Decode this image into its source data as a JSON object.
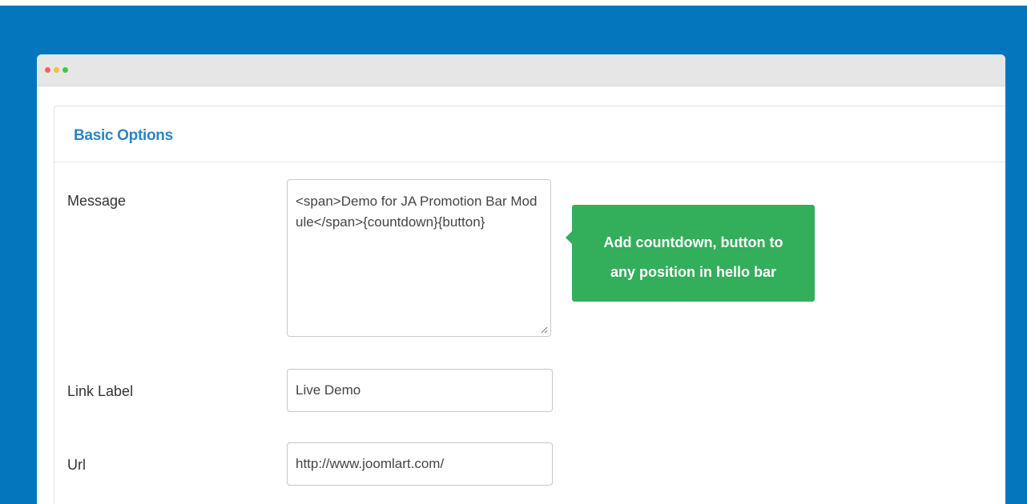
{
  "window": {
    "controls": [
      "close",
      "minimize",
      "maximize"
    ]
  },
  "panel": {
    "title": "Basic Options"
  },
  "fields": {
    "message": {
      "label": "Message",
      "value": "<span>Demo for JA Promotion Bar Module</span>{countdown}{button}"
    },
    "link_label": {
      "label": "Link Label",
      "value": "Live Demo"
    },
    "url": {
      "label": "Url",
      "value": "http://www.joomlart.com/"
    }
  },
  "tooltip": {
    "line1": "Add countdown, button to",
    "line2": "any position in hello bar"
  },
  "colors": {
    "background": "#0476bd",
    "title": "#2a85c8",
    "tooltip": "#33ae5b"
  },
  "icons": {
    "close": "red-dot-icon",
    "minimize": "yellow-dot-icon",
    "maximize": "green-dot-icon",
    "resize": "resize-grip-icon"
  }
}
